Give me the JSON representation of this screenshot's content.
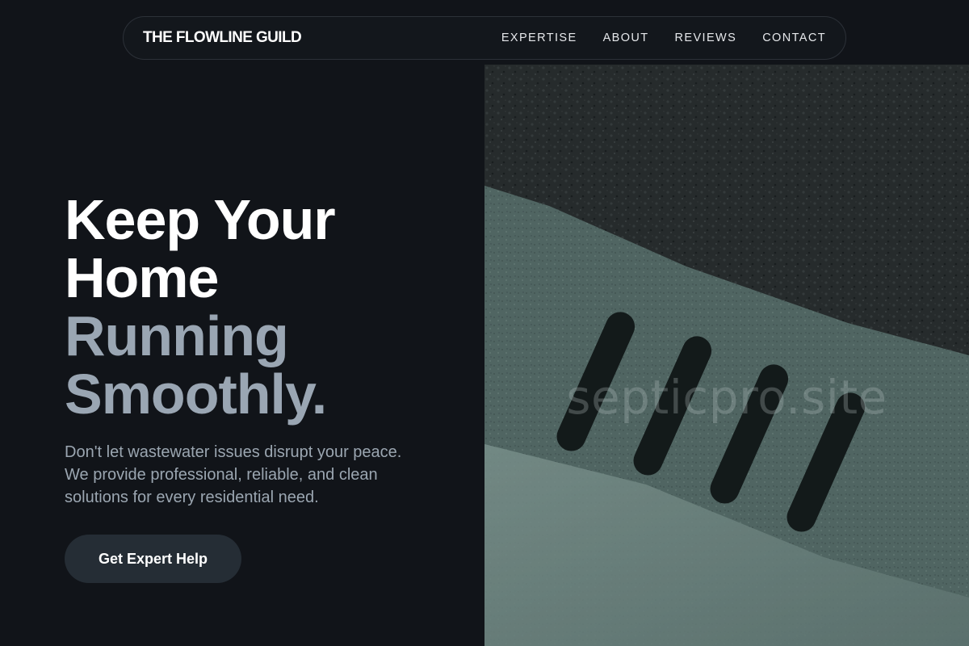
{
  "brand": "THE FLOWLINE GUILD",
  "nav": {
    "items": [
      {
        "label": "EXPERTISE"
      },
      {
        "label": "ABOUT"
      },
      {
        "label": "REVIEWS"
      },
      {
        "label": "CONTACT"
      }
    ]
  },
  "hero": {
    "headline_line1": "Keep Your",
    "headline_line2": "Home",
    "headline_line3": "Running",
    "headline_line4": "Smoothly.",
    "description": "Don't let wastewater issues disrupt your peace. We provide professional, reliable, and clean solutions for every residential need.",
    "cta_label": "Get Expert Help"
  },
  "image": {
    "watermark": "septicpro.site"
  },
  "colors": {
    "background": "#111419",
    "headline_white": "#ffffff",
    "headline_muted": "#9aa6b3",
    "button_bg": "#252d35"
  }
}
